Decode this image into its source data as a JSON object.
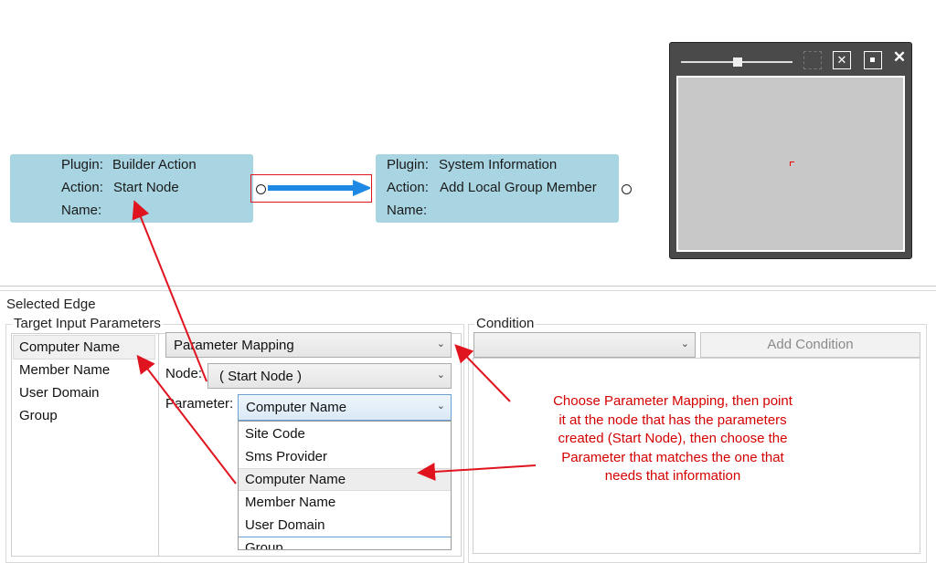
{
  "canvas": {
    "node_left": {
      "plugin_label": "Plugin:",
      "plugin_value": "Builder Action",
      "action_label": "Action:",
      "action_value": "Start Node",
      "name_label": "Name:"
    },
    "node_right": {
      "plugin_label": "Plugin:",
      "plugin_value": "System Information",
      "action_label": "Action:",
      "action_value": "Add Local Group Member",
      "name_label": "Name:"
    }
  },
  "minimap": {
    "icons": [
      "fit-icon",
      "expand-icon",
      "center-icon",
      "close-icon"
    ],
    "zoom_level_fraction": 0.45
  },
  "panel": {
    "title": "Selected Edge",
    "target_params": {
      "legend": "Target Input Parameters",
      "items": [
        "Computer Name",
        "Member Name",
        "User Domain",
        "Group"
      ]
    },
    "mapping": {
      "type_value": "Parameter Mapping",
      "node_label": "Node:",
      "node_value": "( Start Node )",
      "param_label": "Parameter:",
      "param_value": "Computer Name",
      "dropdown_options": [
        "Site Code",
        "Sms Provider",
        "Computer Name",
        "Member Name",
        "User Domain",
        "Group"
      ]
    },
    "condition": {
      "legend": "Condition",
      "add_button": "Add Condition"
    }
  },
  "annotation": {
    "lines": [
      "Choose Parameter Mapping, then point",
      "it at the node that has the parameters",
      "created (Start Node), then choose the",
      "Parameter that matches the one that",
      "needs that information"
    ]
  },
  "colors": {
    "node_fill": "#a9d5e3",
    "edge_arrow": "#1e88e5",
    "annotation_red": "#d40000",
    "selection_red": "#e0141e"
  }
}
